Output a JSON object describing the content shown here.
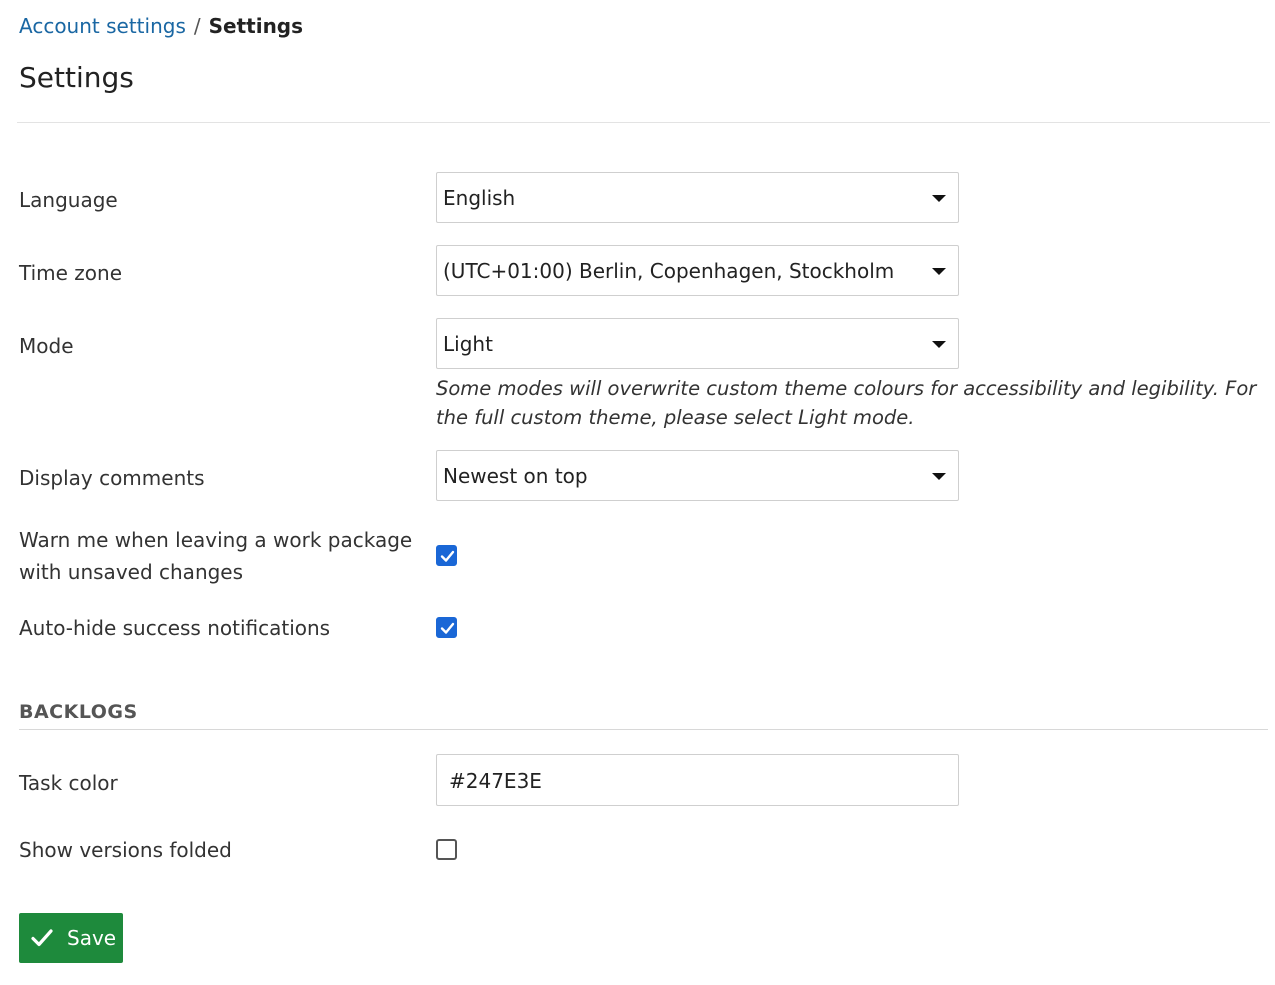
{
  "breadcrumb": {
    "parent": "Account settings",
    "separator": "/",
    "current": "Settings"
  },
  "page_title": "Settings",
  "fields": {
    "language": {
      "label": "Language",
      "value": "English"
    },
    "timezone": {
      "label": "Time zone",
      "value": "(UTC+01:00) Berlin, Copenhagen, Stockholm"
    },
    "mode": {
      "label": "Mode",
      "value": "Light",
      "help": "Some modes will overwrite custom theme colours for accessibility and legibility. For the full custom theme, please select Light mode."
    },
    "comments": {
      "label": "Display comments",
      "value": "Newest on top"
    },
    "warn_unsaved": {
      "label_line1": "Warn me when leaving a work package",
      "label_line2": "with unsaved changes",
      "checked": true
    },
    "autohide": {
      "label": "Auto-hide success notifications",
      "checked": true
    }
  },
  "backlogs": {
    "section_title": "BACKLOGS",
    "task_color": {
      "label": "Task color",
      "value": "#247E3E"
    },
    "versions_folded": {
      "label": "Show versions folded",
      "checked": false
    }
  },
  "save_label": "Save",
  "colors": {
    "link": "#1a67a3",
    "checkbox": "#1a67d6",
    "save": "#1e8a3c"
  },
  "icons": {
    "select_caret": "chevron-down-icon",
    "checkbox_check": "check-icon",
    "save": "check-icon"
  }
}
